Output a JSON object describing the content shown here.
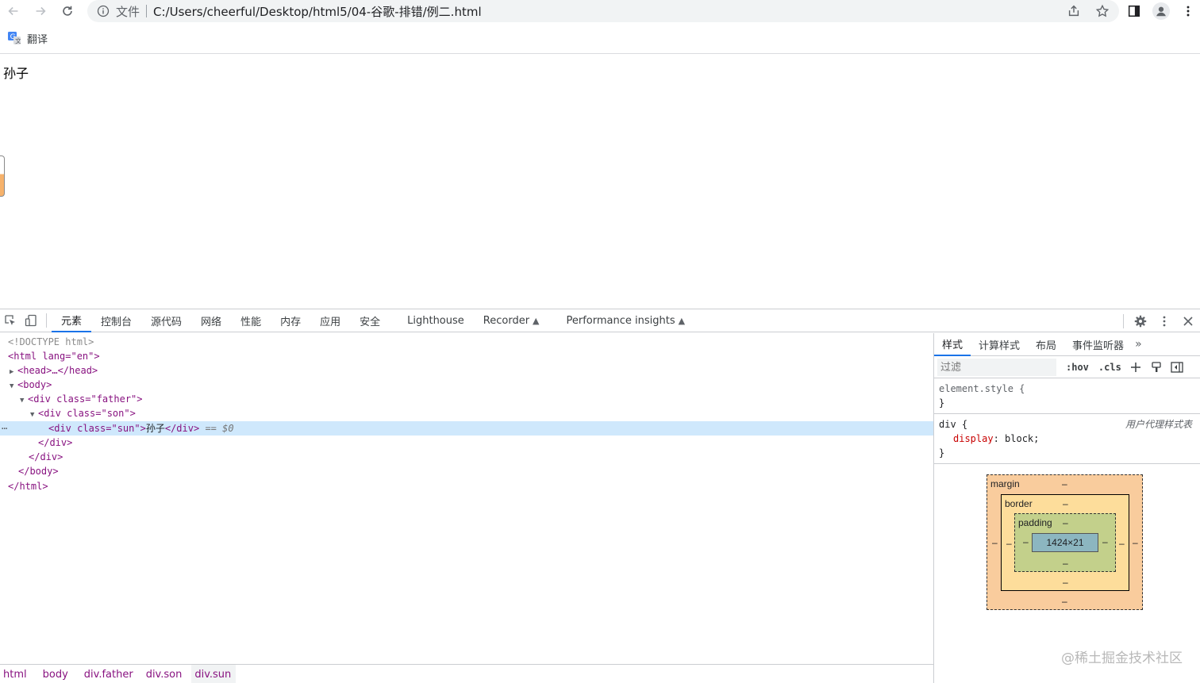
{
  "browser": {
    "scheme": "文件",
    "url": "C:/Users/cheerful/Desktop/html5/04-谷歌-排错/例二.html",
    "bookmark_label": "翻译"
  },
  "page": {
    "text": "孙子"
  },
  "devtools": {
    "tabs": [
      {
        "label": "元素"
      },
      {
        "label": "控制台"
      },
      {
        "label": "源代码"
      },
      {
        "label": "网络"
      },
      {
        "label": "性能"
      },
      {
        "label": "内存"
      },
      {
        "label": "应用"
      },
      {
        "label": "安全"
      },
      {
        "label": "Lighthouse"
      },
      {
        "label": "Recorder"
      },
      {
        "label": "Performance insights"
      }
    ],
    "tree": {
      "doctype": "<!DOCTYPE html>",
      "html_open": "<html lang=\"en\">",
      "head": "<head>…</head>",
      "body_open": "<body>",
      "father_open": "<div class=\"father\">",
      "son_open": "<div class=\"son\">",
      "sun_open": "<div class=\"sun\">",
      "sun_text": "孙子",
      "sun_close": "</div>",
      "sun_marker": "== $0",
      "son_close": "</div>",
      "father_close": "</div>",
      "body_close": "</body>",
      "html_close": "</html>"
    },
    "breadcrumbs": [
      "html",
      "body",
      "div.father",
      "div.son",
      "div.sun"
    ],
    "styles": {
      "tabs": [
        "样式",
        "计算样式",
        "布局",
        "事件监听器"
      ],
      "filter_placeholder": "过滤",
      "hov": ":hov",
      "cls": ".cls",
      "element_style_selector": "element.style {",
      "rule_close": "}",
      "div_selector": "div {",
      "div_origin": "用户代理样式表",
      "div_prop": "display",
      "div_value": "block;"
    },
    "box_model": {
      "margin_label": "margin",
      "border_label": "border",
      "padding_label": "padding",
      "content_size": "1424×21",
      "dash": "–"
    }
  },
  "watermark": "@稀土掘金技术社区"
}
